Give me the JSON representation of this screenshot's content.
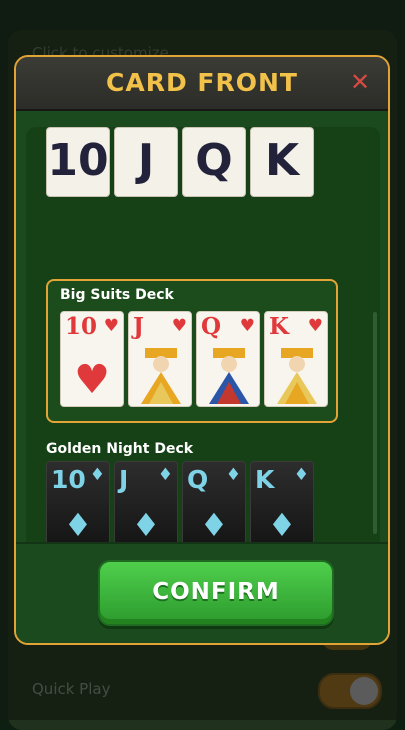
{
  "background": {
    "hint": "Click to customize",
    "quick_play_label": "Quick Play"
  },
  "modal": {
    "title": "CARD FRONT",
    "close_icon": "close-icon",
    "confirm_label": "CONFIRM"
  },
  "decks": [
    {
      "name": "",
      "cards": [
        "10",
        "J",
        "Q",
        "K"
      ]
    },
    {
      "name": "Big Suits Deck",
      "suit": "♥",
      "cards": [
        "10",
        "J",
        "Q",
        "K"
      ]
    },
    {
      "name": "Golden Night Deck",
      "suit": "♦",
      "cards": [
        "10",
        "J",
        "Q",
        "K"
      ]
    }
  ],
  "colors": {
    "accent_gold": "#e2a437",
    "confirm_green": "#3dbb3b",
    "close_red": "#d64a43",
    "heart_red": "#e0393b",
    "diamond_cyan": "#7fd3e6"
  }
}
